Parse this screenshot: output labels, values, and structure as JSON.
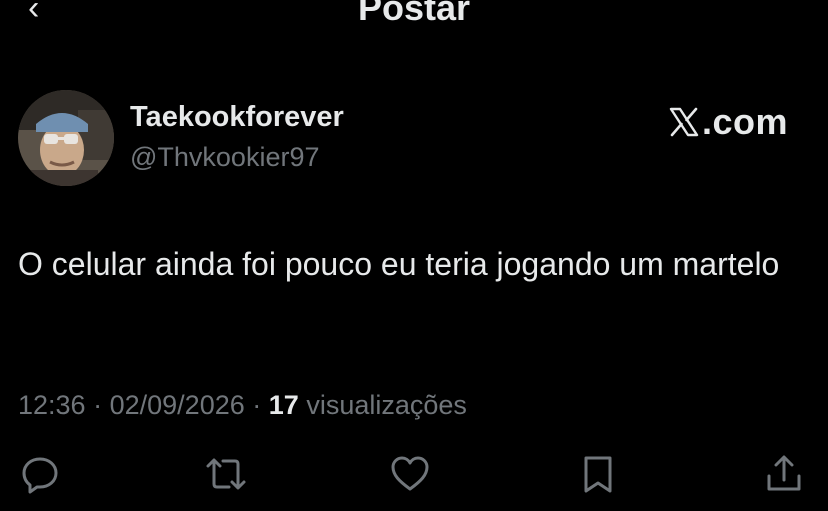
{
  "header": {
    "back_glyph": "‹",
    "title_partial": "Postar"
  },
  "tweet": {
    "display_name": "Taekookforever",
    "handle": "@Thvkookier97",
    "brand_text": ".com",
    "text": "O celular ainda foi pouco eu teria jogando um martelo",
    "time": "12:36",
    "date": "02/09/2026",
    "separator": "·",
    "views_count": "17",
    "views_label": "visualizações"
  },
  "actions": [
    {
      "name": "reply",
      "icon": "reply-icon"
    },
    {
      "name": "repost",
      "icon": "repost-icon"
    },
    {
      "name": "like",
      "icon": "heart-icon"
    },
    {
      "name": "bookmark",
      "icon": "bookmark-icon"
    },
    {
      "name": "share",
      "icon": "share-icon"
    }
  ],
  "colors": {
    "background": "#000000",
    "text": "#e7e9ea",
    "secondary_text": "#71767b"
  }
}
